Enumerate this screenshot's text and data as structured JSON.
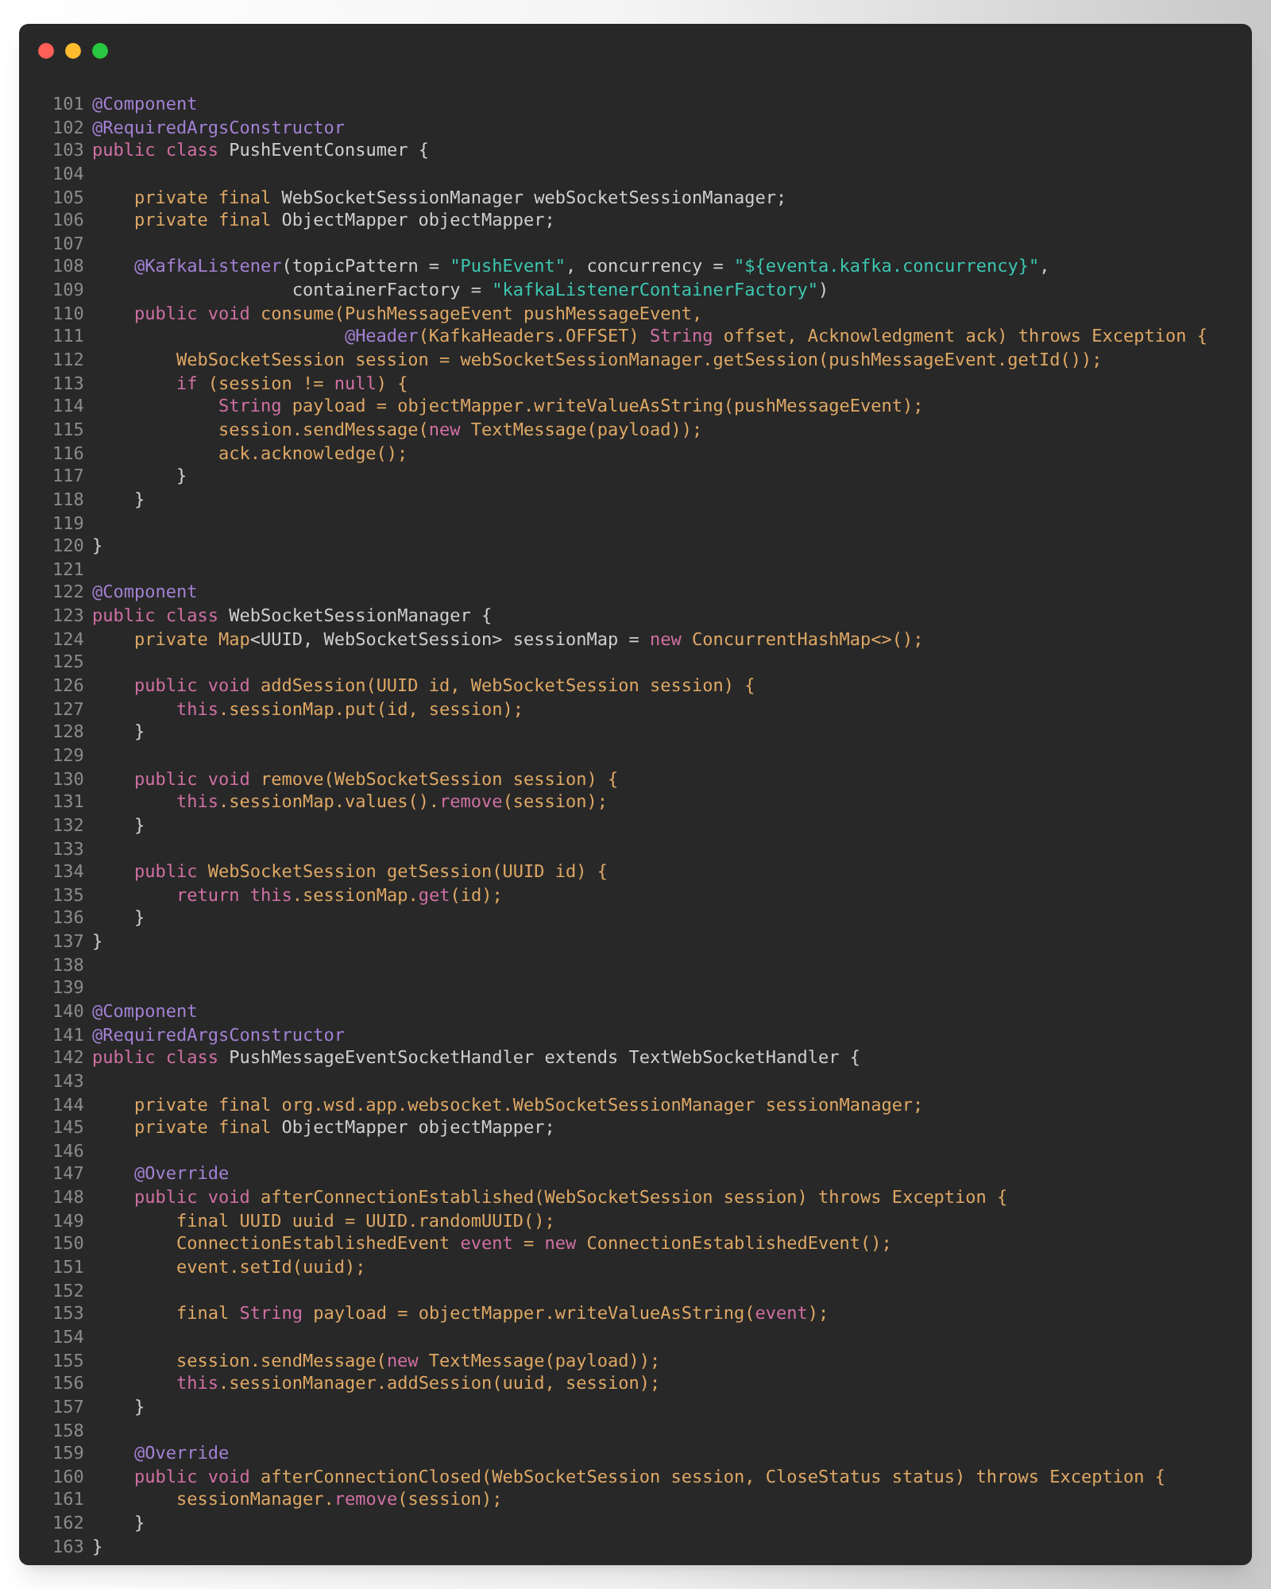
{
  "lines": [
    {
      "number": "101",
      "tokens": [
        {
          "kind": "ann",
          "text": "@Component"
        }
      ]
    },
    {
      "number": "102",
      "tokens": [
        {
          "kind": "ann",
          "text": "@RequiredArgsConstructor"
        }
      ]
    },
    {
      "number": "103",
      "tokens": [
        {
          "kind": "kw",
          "text": "public class"
        },
        {
          "kind": "plain",
          "text": " PushEventConsumer {"
        }
      ]
    },
    {
      "number": "104"
    },
    {
      "number": "105",
      "tokens": [
        {
          "kind": "orange",
          "text": "    private final"
        },
        {
          "kind": "plain",
          "text": " WebSocketSessionManager webSocketSessionManager;"
        }
      ]
    },
    {
      "number": "106",
      "tokens": [
        {
          "kind": "orange",
          "text": "    private final"
        },
        {
          "kind": "plain",
          "text": " ObjectMapper objectMapper;"
        }
      ]
    },
    {
      "number": "107"
    },
    {
      "number": "108",
      "tokens": [
        {
          "kind": "ann",
          "text": "    @KafkaListener"
        },
        {
          "kind": "plain",
          "text": "(topicPattern = "
        },
        {
          "kind": "str",
          "text": "\"PushEvent\""
        },
        {
          "kind": "plain",
          "text": ", concurrency = "
        },
        {
          "kind": "str",
          "text": "\"${eventa.kafka.concurrency}\""
        },
        {
          "kind": "plain",
          "text": ","
        }
      ]
    },
    {
      "number": "109",
      "tokens": [
        {
          "kind": "plain",
          "text": "                   containerFactory = "
        },
        {
          "kind": "str",
          "text": "\"kafkaListenerContainerFactory\""
        },
        {
          "kind": "plain",
          "text": ")"
        }
      ]
    },
    {
      "number": "110",
      "tokens": [
        {
          "kind": "kw",
          "text": "    public void"
        },
        {
          "kind": "orange",
          "text": " consume(PushMessageEvent pushMessageEvent,"
        }
      ]
    },
    {
      "number": "111",
      "tokens": [
        {
          "kind": "ann",
          "text": "                        @Header"
        },
        {
          "kind": "orange",
          "text": "(KafkaHeaders.OFFSET) "
        },
        {
          "kind": "kw",
          "text": "String"
        },
        {
          "kind": "orange",
          "text": " offset, Acknowledgment ack) throws Exception {"
        }
      ]
    },
    {
      "number": "112",
      "tokens": [
        {
          "kind": "orange",
          "text": "        WebSocketSession session = webSocketSessionManager.getSession(pushMessageEvent.getId());"
        }
      ]
    },
    {
      "number": "113",
      "tokens": [
        {
          "kind": "kw",
          "text": "        if"
        },
        {
          "kind": "orange",
          "text": " (session != "
        },
        {
          "kind": "kw",
          "text": "null"
        },
        {
          "kind": "orange",
          "text": ") {"
        }
      ]
    },
    {
      "number": "114",
      "tokens": [
        {
          "kind": "kw",
          "text": "            String"
        },
        {
          "kind": "orange",
          "text": " payload = objectMapper.writeValueAsString(pushMessageEvent);"
        }
      ]
    },
    {
      "number": "115",
      "tokens": [
        {
          "kind": "orange",
          "text": "            session.sendMessage("
        },
        {
          "kind": "kw",
          "text": "new"
        },
        {
          "kind": "orange",
          "text": " TextMessage(payload));"
        }
      ]
    },
    {
      "number": "116",
      "tokens": [
        {
          "kind": "orange",
          "text": "            ack.acknowledge();"
        }
      ]
    },
    {
      "number": "117",
      "tokens": [
        {
          "kind": "plain",
          "text": "        }"
        }
      ]
    },
    {
      "number": "118",
      "tokens": [
        {
          "kind": "plain",
          "text": "    }"
        }
      ]
    },
    {
      "number": "119"
    },
    {
      "number": "120",
      "tokens": [
        {
          "kind": "plain",
          "text": "}"
        }
      ]
    },
    {
      "number": "121"
    },
    {
      "number": "122",
      "tokens": [
        {
          "kind": "ann",
          "text": "@Component"
        }
      ]
    },
    {
      "number": "123",
      "tokens": [
        {
          "kind": "kw",
          "text": "public class"
        },
        {
          "kind": "plain",
          "text": " WebSocketSessionManager {"
        }
      ]
    },
    {
      "number": "124",
      "tokens": [
        {
          "kind": "orange",
          "text": "    private Map"
        },
        {
          "kind": "plain",
          "text": "<UUID, WebSocketSession> sessionMap = "
        },
        {
          "kind": "kw",
          "text": "new"
        },
        {
          "kind": "orange",
          "text": " ConcurrentHashMap<>();"
        }
      ]
    },
    {
      "number": "125"
    },
    {
      "number": "126",
      "tokens": [
        {
          "kind": "kw",
          "text": "    public void"
        },
        {
          "kind": "orange",
          "text": " addSession(UUID id, WebSocketSession session) {"
        }
      ]
    },
    {
      "number": "127",
      "tokens": [
        {
          "kind": "kw",
          "text": "        this"
        },
        {
          "kind": "orange",
          "text": ".sessionMap.put(id, session);"
        }
      ]
    },
    {
      "number": "128",
      "tokens": [
        {
          "kind": "plain",
          "text": "    }"
        }
      ]
    },
    {
      "number": "129"
    },
    {
      "number": "130",
      "tokens": [
        {
          "kind": "kw",
          "text": "    public void"
        },
        {
          "kind": "orange",
          "text": " remove(WebSocketSession session) {"
        }
      ]
    },
    {
      "number": "131",
      "tokens": [
        {
          "kind": "kw",
          "text": "        this"
        },
        {
          "kind": "orange",
          "text": ".sessionMap.values()."
        },
        {
          "kind": "kw",
          "text": "remove"
        },
        {
          "kind": "orange",
          "text": "(session);"
        }
      ]
    },
    {
      "number": "132",
      "tokens": [
        {
          "kind": "plain",
          "text": "    }"
        }
      ]
    },
    {
      "number": "133"
    },
    {
      "number": "134",
      "tokens": [
        {
          "kind": "kw",
          "text": "    public"
        },
        {
          "kind": "orange",
          "text": " WebSocketSession getSession(UUID id) {"
        }
      ]
    },
    {
      "number": "135",
      "tokens": [
        {
          "kind": "kw",
          "text": "        return this"
        },
        {
          "kind": "orange",
          "text": ".sessionMap."
        },
        {
          "kind": "kw",
          "text": "get"
        },
        {
          "kind": "orange",
          "text": "(id);"
        }
      ]
    },
    {
      "number": "136",
      "tokens": [
        {
          "kind": "plain",
          "text": "    }"
        }
      ]
    },
    {
      "number": "137",
      "tokens": [
        {
          "kind": "plain",
          "text": "}"
        }
      ]
    },
    {
      "number": "138"
    },
    {
      "number": "139"
    },
    {
      "number": "140",
      "tokens": [
        {
          "kind": "ann",
          "text": "@Component"
        }
      ]
    },
    {
      "number": "141",
      "tokens": [
        {
          "kind": "ann",
          "text": "@RequiredArgsConstructor"
        }
      ]
    },
    {
      "number": "142",
      "tokens": [
        {
          "kind": "kw",
          "text": "public class"
        },
        {
          "kind": "plain",
          "text": " PushMessageEventSocketHandler extends TextWebSocketHandler {"
        }
      ]
    },
    {
      "number": "143"
    },
    {
      "number": "144",
      "tokens": [
        {
          "kind": "orange",
          "text": "    private final org.wsd.app.websocket.WebSocketSessionManager sessionManager;"
        }
      ]
    },
    {
      "number": "145",
      "tokens": [
        {
          "kind": "orange",
          "text": "    private final"
        },
        {
          "kind": "plain",
          "text": " ObjectMapper objectMapper;"
        }
      ]
    },
    {
      "number": "146"
    },
    {
      "number": "147",
      "tokens": [
        {
          "kind": "ann",
          "text": "    @Override"
        }
      ]
    },
    {
      "number": "148",
      "tokens": [
        {
          "kind": "kw",
          "text": "    public void"
        },
        {
          "kind": "orange",
          "text": " afterConnectionEstablished(WebSocketSession session) throws Exception {"
        }
      ]
    },
    {
      "number": "149",
      "tokens": [
        {
          "kind": "orange",
          "text": "        final UUID uuid = UUID.randomUUID();"
        }
      ]
    },
    {
      "number": "150",
      "tokens": [
        {
          "kind": "orange",
          "text": "        ConnectionEstablishedEvent "
        },
        {
          "kind": "kw",
          "text": "event"
        },
        {
          "kind": "orange",
          "text": " = "
        },
        {
          "kind": "kw",
          "text": "new"
        },
        {
          "kind": "orange",
          "text": " ConnectionEstablishedEvent();"
        }
      ]
    },
    {
      "number": "151",
      "tokens": [
        {
          "kind": "orange",
          "text": "        event.setId(uuid);"
        }
      ]
    },
    {
      "number": "152"
    },
    {
      "number": "153",
      "tokens": [
        {
          "kind": "orange",
          "text": "        final "
        },
        {
          "kind": "kw",
          "text": "String"
        },
        {
          "kind": "orange",
          "text": " payload = objectMapper.writeValueAsString("
        },
        {
          "kind": "kw",
          "text": "event"
        },
        {
          "kind": "orange",
          "text": ");"
        }
      ]
    },
    {
      "number": "154"
    },
    {
      "number": "155",
      "tokens": [
        {
          "kind": "orange",
          "text": "        session.sendMessage("
        },
        {
          "kind": "kw",
          "text": "new"
        },
        {
          "kind": "orange",
          "text": " TextMessage(payload));"
        }
      ]
    },
    {
      "number": "156",
      "tokens": [
        {
          "kind": "kw",
          "text": "        this"
        },
        {
          "kind": "orange",
          "text": ".sessionManager.addSession(uuid, session);"
        }
      ]
    },
    {
      "number": "157",
      "tokens": [
        {
          "kind": "plain",
          "text": "    }"
        }
      ]
    },
    {
      "number": "158"
    },
    {
      "number": "159",
      "tokens": [
        {
          "kind": "ann",
          "text": "    @Override"
        }
      ]
    },
    {
      "number": "160",
      "tokens": [
        {
          "kind": "kw",
          "text": "    public void"
        },
        {
          "kind": "orange",
          "text": " afterConnectionClosed(WebSocketSession session, CloseStatus status) throws Exception {"
        }
      ]
    },
    {
      "number": "161",
      "tokens": [
        {
          "kind": "orange",
          "text": "        sessionManager."
        },
        {
          "kind": "kw",
          "text": "remove"
        },
        {
          "kind": "orange",
          "text": "(session);"
        }
      ]
    },
    {
      "number": "162",
      "tokens": [
        {
          "kind": "plain",
          "text": "    }"
        }
      ]
    },
    {
      "number": "163",
      "tokens": [
        {
          "kind": "plain",
          "text": "}"
        }
      ]
    }
  ]
}
